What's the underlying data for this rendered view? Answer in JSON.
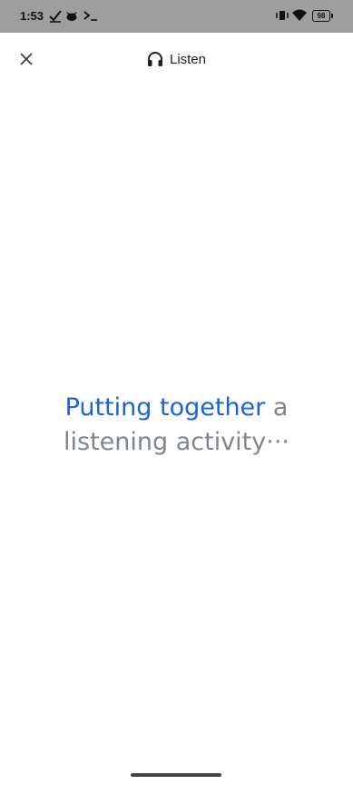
{
  "status_bar": {
    "time": "1:53",
    "battery": "98",
    "icons": [
      "check-icon",
      "cat-icon",
      "terminal-icon",
      "vibrate-icon",
      "wifi-icon",
      "battery-icon"
    ]
  },
  "app_bar": {
    "title": "Listen",
    "title_icon": "headphones-icon",
    "close_icon": "close-icon"
  },
  "message": {
    "highlight": "Putting together",
    "rest_line1": " a",
    "line2": "listening activity",
    "ellipsis": "···"
  },
  "colors": {
    "status_bar_bg": "#9e9e9e",
    "accent_blue": "#1a63d8",
    "muted_text": "#80868b"
  }
}
